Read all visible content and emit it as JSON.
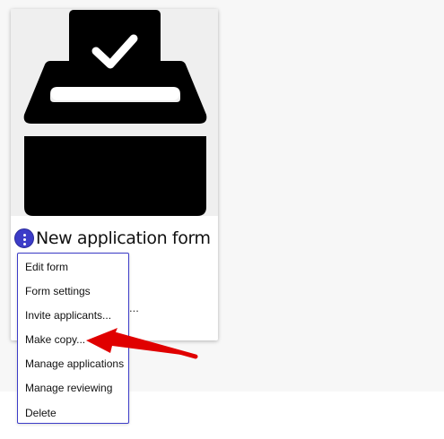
{
  "card": {
    "image_icon": "ballot-box-icon",
    "title": "New application form",
    "subtext": "..."
  },
  "actions_menu": {
    "icon": "kebab-menu-icon",
    "items": [
      {
        "label": "Edit form"
      },
      {
        "label": "Form settings"
      },
      {
        "label": "Invite applicants..."
      },
      {
        "label": "Make copy..."
      },
      {
        "label": "Manage applications"
      },
      {
        "label": "Manage reviewing"
      },
      {
        "label": "Delete"
      }
    ]
  },
  "annotation": {
    "icon": "red-arrow-icon",
    "points_to": "Make copy..."
  },
  "colors": {
    "accent": "#3c3cc8",
    "arrow": "#e00000",
    "icon_fill": "#000000"
  }
}
